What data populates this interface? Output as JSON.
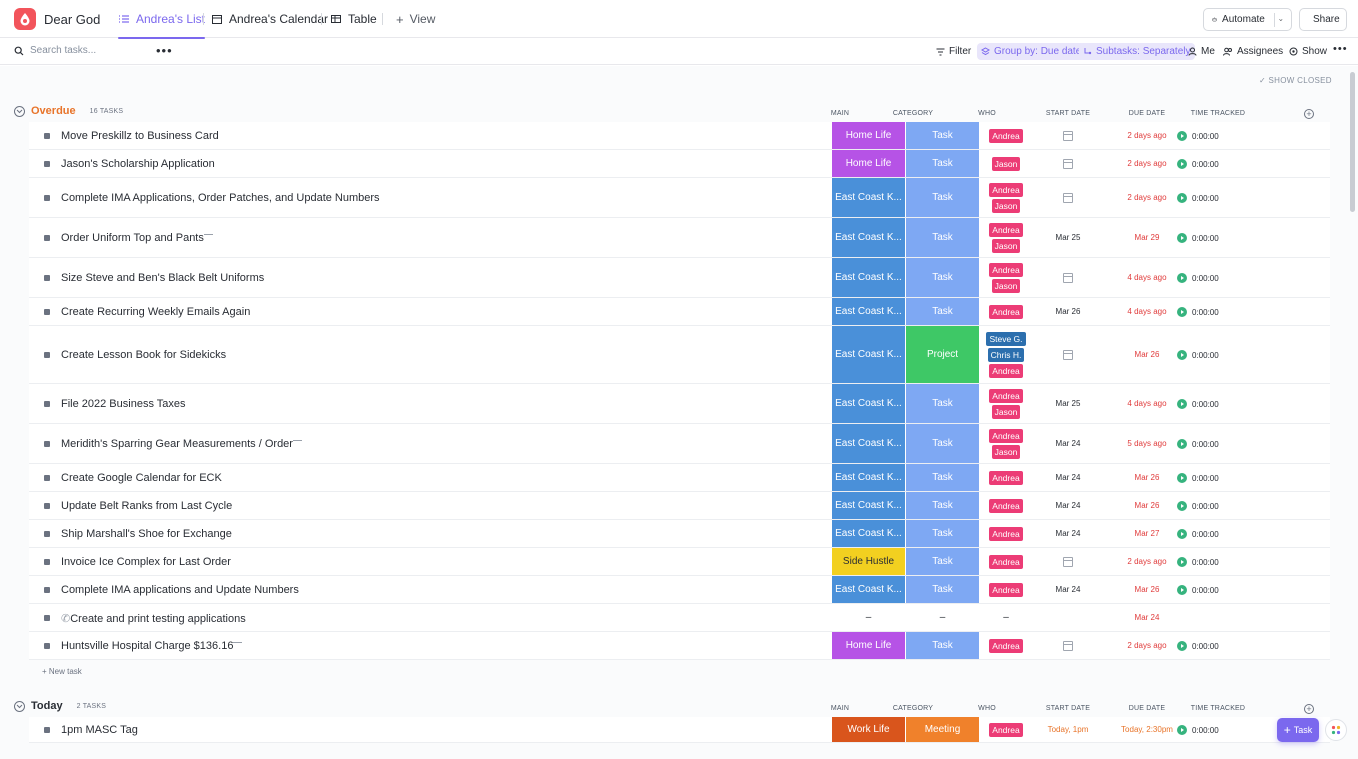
{
  "workspace": {
    "title": "Dear God"
  },
  "tabs": [
    {
      "label": "Andrea's List",
      "active": true,
      "icon": "list-icon"
    },
    {
      "label": "Andrea's Calendar",
      "active": false,
      "icon": "calendar-icon"
    },
    {
      "label": "Table",
      "active": false,
      "icon": "table-icon"
    },
    {
      "label": "View",
      "active": false,
      "icon": "plus-icon"
    }
  ],
  "header_actions": {
    "automate": "Automate",
    "share": "Share"
  },
  "toolbar": {
    "search_placeholder": "Search tasks...",
    "filter": "Filter",
    "group_by": "Group by: Due date",
    "subtasks": "Subtasks: Separately",
    "me": "Me",
    "assignees": "Assignees",
    "show": "Show"
  },
  "show_closed": "SHOW CLOSED",
  "columns": {
    "main": "MAIN",
    "category": "CATEGORY",
    "who": "WHO",
    "start": "START DATE",
    "due": "DUE DATE",
    "time": "TIME TRACKED"
  },
  "colors": {
    "accent": "#7b68ee",
    "overdue": "#e8742a",
    "home_life": "#b653e6",
    "east_coast": "#4a90d9",
    "side_hustle": "#f2d020",
    "work_life": "#d9551c",
    "task": "#7ea8f3",
    "project": "#3ec866",
    "meeting": "#f0812b",
    "andrea": "#ec3c76",
    "steve": "#2c6fae",
    "due_red": "#e03b3b"
  },
  "groups": [
    {
      "name": "Overdue",
      "count": "16 TASKS",
      "new_task": "+ New task",
      "tasks": [
        {
          "name": "Move Preskillz to Business Card",
          "main": "Home Life",
          "category": "Task",
          "who": [
            "Andrea"
          ],
          "start": "",
          "due": "2 days ago",
          "time": "0:00:00"
        },
        {
          "name": "Jason's Scholarship Application",
          "main": "Home Life",
          "category": "Task",
          "who": [
            "Jason"
          ],
          "start": "",
          "due": "2 days ago",
          "time": "0:00:00"
        },
        {
          "name": "Complete IMA Applications, Order Patches, and Update Numbers",
          "main": "East Coast K...",
          "category": "Task",
          "who": [
            "Andrea",
            "Jason"
          ],
          "start": "",
          "due": "2 days ago",
          "time": "0:00:00"
        },
        {
          "name": "Order Uniform Top and Pants",
          "main": "East Coast K...",
          "category": "Task",
          "who": [
            "Andrea",
            "Jason"
          ],
          "start": "Mar 25",
          "due": "Mar 29",
          "time": "0:00:00"
        },
        {
          "name": "Size Steve and Ben's Black Belt Uniforms",
          "main": "East Coast K...",
          "category": "Task",
          "who": [
            "Andrea",
            "Jason"
          ],
          "start": "",
          "due": "4 days ago",
          "time": "0:00:00"
        },
        {
          "name": "Create Recurring Weekly Emails Again",
          "main": "East Coast K...",
          "category": "Task",
          "who": [
            "Andrea"
          ],
          "start": "Mar 26",
          "due": "4 days ago",
          "time": "0:00:00"
        },
        {
          "name": "Create Lesson Book for Sidekicks",
          "main": "East Coast K...",
          "category": "Project",
          "who": [
            "Steve G.",
            "Chris H.",
            "Andrea"
          ],
          "start": "",
          "due": "Mar 26",
          "time": "0:00:00"
        },
        {
          "name": "File 2022 Business Taxes",
          "main": "East Coast K...",
          "category": "Task",
          "who": [
            "Andrea",
            "Jason"
          ],
          "start": "Mar 25",
          "due": "4 days ago",
          "time": "0:00:00"
        },
        {
          "name": "Meridith's Sparring Gear Measurements / Order",
          "main": "East Coast K...",
          "category": "Task",
          "who": [
            "Andrea",
            "Jason"
          ],
          "start": "Mar 24",
          "due": "5 days ago",
          "time": "0:00:00"
        },
        {
          "name": "Create Google Calendar for ECK",
          "main": "East Coast K...",
          "category": "Task",
          "who": [
            "Andrea"
          ],
          "start": "Mar 24",
          "due": "Mar 26",
          "time": "0:00:00"
        },
        {
          "name": "Update Belt Ranks from Last Cycle",
          "main": "East Coast K...",
          "category": "Task",
          "who": [
            "Andrea"
          ],
          "start": "Mar 24",
          "due": "Mar 26",
          "time": "0:00:00"
        },
        {
          "name": "Ship Marshall's Shoe for Exchange",
          "main": "East Coast K...",
          "category": "Task",
          "who": [
            "Andrea"
          ],
          "start": "Mar 24",
          "due": "Mar 27",
          "time": "0:00:00"
        },
        {
          "name": "Invoice Ice Complex for Last Order",
          "main": "Side Hustle",
          "category": "Task",
          "who": [
            "Andrea"
          ],
          "start": "",
          "due": "2 days ago",
          "time": "0:00:00"
        },
        {
          "name": "Complete IMA applications and Update Numbers",
          "main": "East Coast K...",
          "category": "Task",
          "who": [
            "Andrea"
          ],
          "start": "Mar 24",
          "due": "Mar 26",
          "time": "0:00:00"
        },
        {
          "name": "Create and print testing applications",
          "main": "–",
          "category": "–",
          "who": [
            "–"
          ],
          "start": "",
          "due": "Mar 24",
          "time": ""
        },
        {
          "name": "Huntsville Hospital Charge $136.16",
          "main": "Home Life",
          "category": "Task",
          "who": [
            "Andrea"
          ],
          "start": "",
          "due": "2 days ago",
          "time": "0:00:00"
        }
      ]
    },
    {
      "name": "Today",
      "count": "2 TASKS",
      "tasks": [
        {
          "name": "1pm MASC Tag",
          "main": "Work Life",
          "category": "Meeting",
          "who": [
            "Andrea"
          ],
          "start": "Today, 1pm",
          "due": "Today, 2:30pm",
          "time": "0:00:00"
        }
      ]
    }
  ],
  "fab": {
    "label": "Task"
  }
}
